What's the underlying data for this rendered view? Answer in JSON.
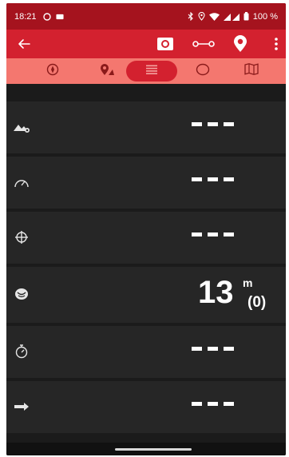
{
  "status_bar": {
    "time": "18:21",
    "battery": "100 %"
  },
  "toolbar": {
    "back_icon": "arrow-left-icon",
    "record_icon": "record-icon",
    "route_icon": "route-icon",
    "pin_icon": "map-pin-icon",
    "more_icon": "more-vert-icon"
  },
  "tabs": [
    {
      "icon": "compass-icon",
      "active": false
    },
    {
      "icon": "waypoint-icon",
      "active": false
    },
    {
      "icon": "list-icon",
      "active": true
    },
    {
      "icon": "circle-icon",
      "active": false
    },
    {
      "icon": "map-icon",
      "active": false
    }
  ],
  "rows": [
    {
      "icon": "elevation-icon",
      "value": "---"
    },
    {
      "icon": "speedometer-icon",
      "value": "---"
    },
    {
      "icon": "crosshair-icon",
      "value": "---"
    },
    {
      "icon": "satellite-accuracy-icon",
      "value": "13",
      "unit": "m",
      "sub": "(0)"
    },
    {
      "icon": "stopwatch-icon",
      "value": "---"
    },
    {
      "icon": "direction-arrow-icon",
      "value": "---"
    }
  ],
  "colors": {
    "status_bar": "#a5131e",
    "toolbar": "#d3212f",
    "tabs_bg": "#f4776f",
    "tab_active": "#d3212f",
    "row_bg": "#262626",
    "screen_bg": "#1b1b1b"
  }
}
